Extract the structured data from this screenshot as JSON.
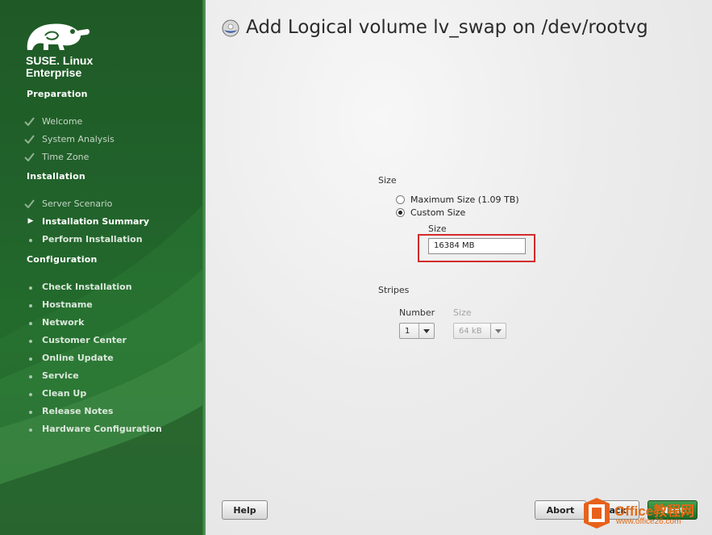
{
  "sidebar": {
    "brand_line1": "SUSE. Linux",
    "brand_line2": "Enterprise",
    "sections": [
      {
        "title": "Preparation"
      },
      {
        "title": "Installation"
      },
      {
        "title": "Configuration"
      }
    ],
    "preparation_steps": [
      "Welcome",
      "System Analysis",
      "Time Zone"
    ],
    "installation_steps": [
      "Server Scenario",
      "Installation Summary",
      "Perform Installation"
    ],
    "configuration_steps": [
      "Check Installation",
      "Hostname",
      "Network",
      "Customer Center",
      "Online Update",
      "Service",
      "Clean Up",
      "Release Notes",
      "Hardware Configuration"
    ]
  },
  "main": {
    "title": "Add Logical volume lv_swap on /dev/rootvg",
    "size_group_label": "Size",
    "max_size_label": "Maximum Size (1.09 TB)",
    "custom_size_label": "Custom Size",
    "size_field_label": "Size",
    "size_value": "16384 MB",
    "stripes_group_label": "Stripes",
    "number_label": "Number",
    "number_value": "1",
    "stripe_size_label": "Size",
    "stripe_size_value": "64 kB"
  },
  "footer": {
    "help_label": "Help",
    "abort_label": "Abort",
    "back_label": "Back",
    "next_label": "Next"
  },
  "watermark": {
    "text": "Office教程网",
    "url": "www.office26.com"
  },
  "colors": {
    "sidebar_green": "#21612a",
    "highlight_red": "#d42b2b",
    "watermark_orange": "#e06a16"
  }
}
